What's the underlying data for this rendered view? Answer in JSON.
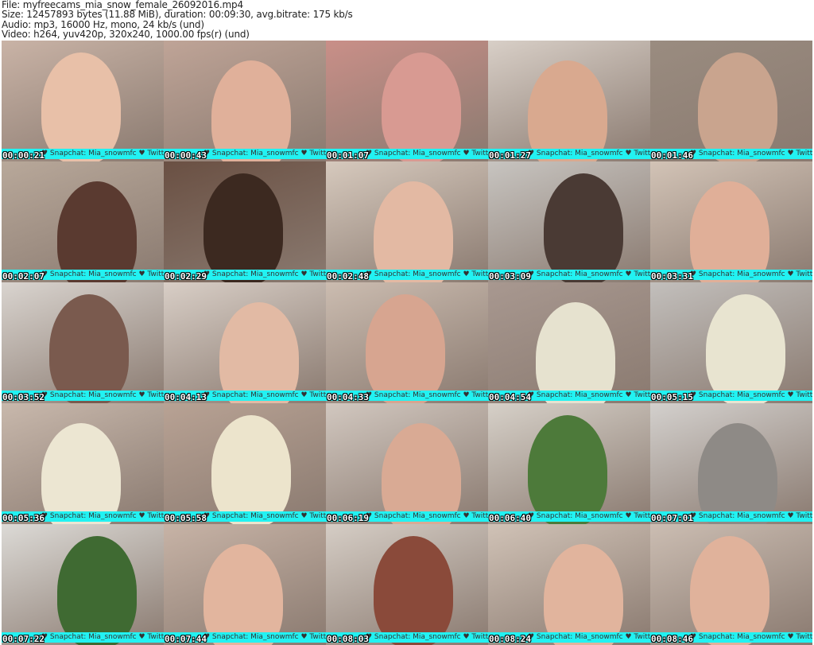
{
  "info": {
    "file": "File: myfreecams_mia_snow_female_26092016.mp4",
    "size": "Size: 12457893 bytes (11.88 MiB), duration: 00:09:30, avg.bitrate: 175 kb/s",
    "audio": "Audio: mp3, 16000 Hz, mono, 24 kb/s (und)",
    "video": "Video: h264, yuv420p, 320x240, 1000.00 fps(r) (und)"
  },
  "overlay_text": "♥ Snapchat: Mia_snowmfc ♥ Twitter: Mia_snowmfc ♥",
  "band_color": "#22f2f2",
  "thumbs": [
    {
      "time": "00:00:21",
      "bg": "#c9b3a6",
      "fig": "#e8c0a8"
    },
    {
      "time": "00:00:43",
      "bg": "#bfa497",
      "fig": "#e0b09a"
    },
    {
      "time": "00:01:07",
      "bg": "#c98f88",
      "fig": "#d89a92"
    },
    {
      "time": "00:01:27",
      "bg": "#d8cfc7",
      "fig": "#d9a98f"
    },
    {
      "time": "00:01:46",
      "bg": "#9a8c80",
      "fig": "#c9a48e"
    },
    {
      "time": "00:02:07",
      "bg": "#b8a89a",
      "fig": "#5a3a30"
    },
    {
      "time": "00:02:29",
      "bg": "#6a5043",
      "fig": "#3c2920"
    },
    {
      "time": "00:02:48",
      "bg": "#d6c9bd",
      "fig": "#e3b9a3"
    },
    {
      "time": "00:03:09",
      "bg": "#c7c4c0",
      "fig": "#4a3a34"
    },
    {
      "time": "00:03:31",
      "bg": "#d2c3b6",
      "fig": "#e0af98"
    },
    {
      "time": "00:03:52",
      "bg": "#d9d4cf",
      "fig": "#7a5a4e"
    },
    {
      "time": "00:04:13",
      "bg": "#d8cec6",
      "fig": "#e2baa4"
    },
    {
      "time": "00:04:33",
      "bg": "#cbbcb0",
      "fig": "#d7a590"
    },
    {
      "time": "00:04:54",
      "bg": "#a89890",
      "fig": "#e6e2cf"
    },
    {
      "time": "00:05:15",
      "bg": "#c2bfbc",
      "fig": "#e8e4d0"
    },
    {
      "time": "00:05:36",
      "bg": "#c8b8ac",
      "fig": "#ece6d2"
    },
    {
      "time": "00:05:58",
      "bg": "#b8a294",
      "fig": "#ece4cc"
    },
    {
      "time": "00:06:19",
      "bg": "#d1c7bf",
      "fig": "#d9aa94"
    },
    {
      "time": "00:06:40",
      "bg": "#d6d0c8",
      "fig": "#4d7a3a"
    },
    {
      "time": "00:07:01",
      "bg": "#d3d0cd",
      "fig": "#8e8a86"
    },
    {
      "time": "00:07:22",
      "bg": "#dcdad6",
      "fig": "#3f6a32"
    },
    {
      "time": "00:07:44",
      "bg": "#c7b3a6",
      "fig": "#e2b59e"
    },
    {
      "time": "00:08:03",
      "bg": "#d5cdc5",
      "fig": "#8a4a3a"
    },
    {
      "time": "00:08:24",
      "bg": "#d0c2b6",
      "fig": "#e1b49d"
    },
    {
      "time": "00:08:46",
      "bg": "#cbbdb2",
      "fig": "#e0b29b"
    }
  ]
}
